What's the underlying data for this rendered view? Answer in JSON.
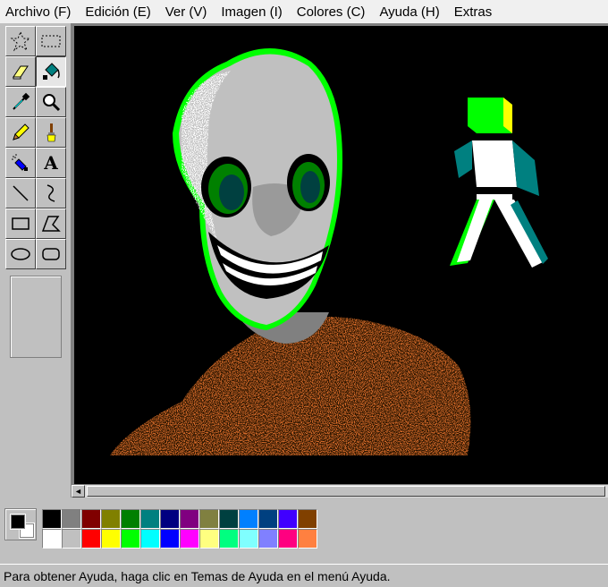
{
  "menu": {
    "items": [
      "Archivo (F)",
      "Edición (E)",
      "Ver (V)",
      "Imagen (I)",
      "Colores (C)",
      "Ayuda (H)",
      "Extras"
    ]
  },
  "toolbox": {
    "tools": [
      {
        "name": "free-select",
        "icon": "free-select-icon",
        "active": false
      },
      {
        "name": "rect-select",
        "icon": "rect-select-icon",
        "active": false
      },
      {
        "name": "eraser",
        "icon": "eraser-icon",
        "active": false
      },
      {
        "name": "fill",
        "icon": "fill-bucket-icon",
        "active": true
      },
      {
        "name": "color-picker",
        "icon": "eyedropper-icon",
        "active": false
      },
      {
        "name": "magnifier",
        "icon": "magnifier-icon",
        "active": false
      },
      {
        "name": "pencil",
        "icon": "pencil-icon",
        "active": false
      },
      {
        "name": "brush",
        "icon": "brush-icon",
        "active": false
      },
      {
        "name": "airbrush",
        "icon": "airbrush-icon",
        "active": false
      },
      {
        "name": "text",
        "icon": "text-icon",
        "active": false
      },
      {
        "name": "line",
        "icon": "line-icon",
        "active": false
      },
      {
        "name": "curve",
        "icon": "curve-icon",
        "active": false
      },
      {
        "name": "rectangle",
        "icon": "rectangle-icon",
        "active": false
      },
      {
        "name": "polygon",
        "icon": "polygon-icon",
        "active": false
      },
      {
        "name": "ellipse",
        "icon": "ellipse-icon",
        "active": false
      },
      {
        "name": "rounded-rectangle",
        "icon": "rounded-rectangle-icon",
        "active": false
      }
    ],
    "text_tool_glyph": "A"
  },
  "colors": {
    "foreground": "#000000",
    "background": "#ffffff",
    "palette": [
      "#000000",
      "#808080",
      "#800000",
      "#808000",
      "#008000",
      "#008080",
      "#000080",
      "#800080",
      "#808040",
      "#004040",
      "#0080ff",
      "#004080",
      "#4000ff",
      "#804000",
      "#ffffff",
      "#c0c0c0",
      "#ff0000",
      "#ffff00",
      "#00ff00",
      "#00ffff",
      "#0000ff",
      "#ff00ff",
      "#ffff80",
      "#00ff80",
      "#80ffff",
      "#8080ff",
      "#ff0080",
      "#ff8040"
    ]
  },
  "scrollbar": {
    "left_arrow": "◄"
  },
  "status": {
    "text": "Para obtener Ayuda, haga clic en Temas de Ayuda en el menú Ayuda."
  }
}
